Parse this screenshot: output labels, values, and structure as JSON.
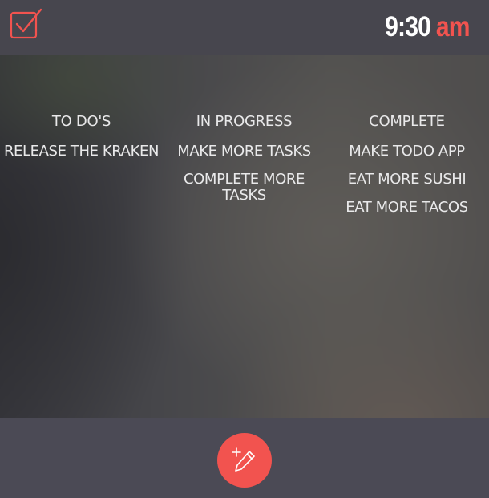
{
  "header": {
    "logo_icon": "checkbox-checked-icon",
    "clock": {
      "time": "9:30",
      "period": "am"
    }
  },
  "columns": [
    {
      "title": "TO DO'S",
      "tasks": [
        "RELEASE THE KRAKEN"
      ]
    },
    {
      "title": "IN PROGRESS",
      "tasks": [
        "MAKE MORE TASKS",
        "COMPLETE MORE TASKS"
      ]
    },
    {
      "title": "COMPLETE",
      "tasks": [
        "MAKE TODO APP",
        "EAT MORE SUSHI",
        "EAT MORE TACOS"
      ]
    }
  ],
  "footer": {
    "add_button_icon": "add-edit-pencil-icon"
  },
  "colors": {
    "accent": "#f2534f",
    "topbar": "#47464e",
    "bottombar": "#4b4a55",
    "text": "#e9e9ea"
  }
}
